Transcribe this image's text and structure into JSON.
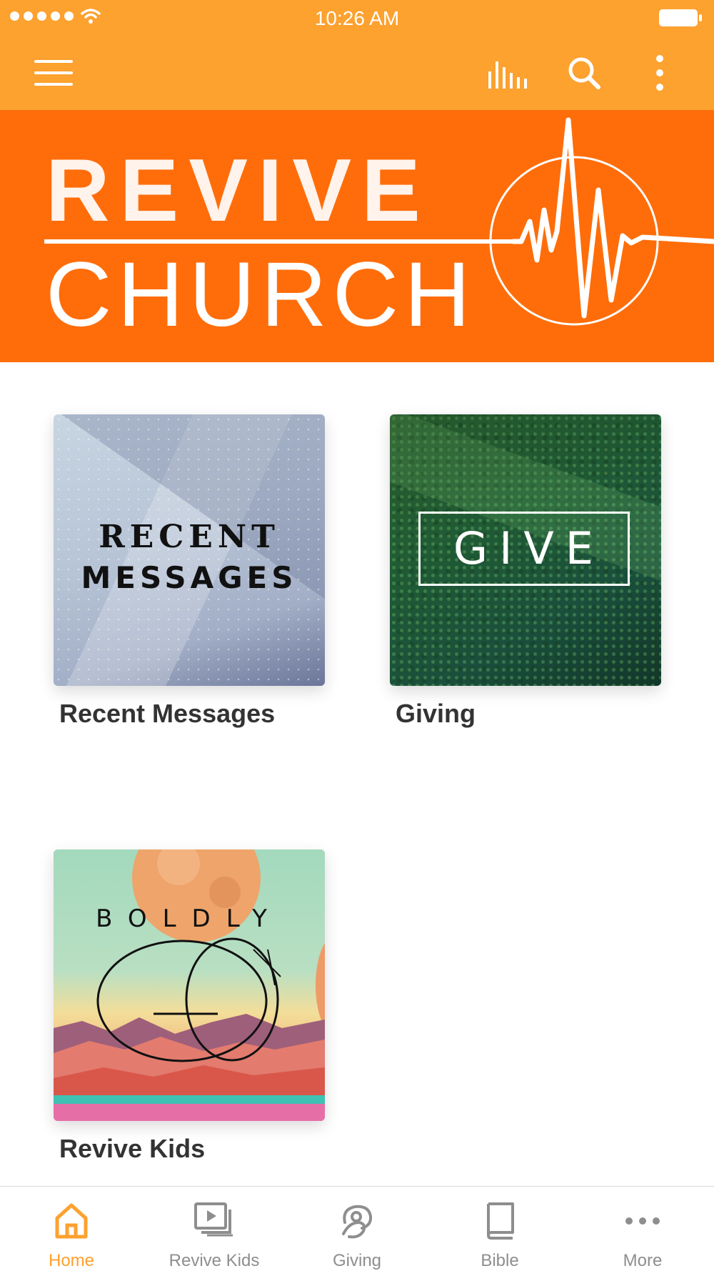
{
  "status_bar": {
    "time": "10:26 AM"
  },
  "toolbar": {
    "menu": "menu-icon",
    "equalizer": "equalizer-icon",
    "search": "search-icon",
    "more": "kebab-icon"
  },
  "banner": {
    "line1": "REVIVE",
    "line2": "CHURCH"
  },
  "tiles": [
    {
      "title": "Recent Messages",
      "art_line1": "RECENT",
      "art_line2": "MESSAGES"
    },
    {
      "title": "Giving",
      "art_text": "GIVE"
    },
    {
      "title": "Revive Kids",
      "art_line1": "BOLDLY",
      "art_line2": "GO"
    }
  ],
  "tabbar": {
    "active": "Home",
    "items": [
      {
        "label": "Home",
        "icon": "home-icon"
      },
      {
        "label": "Revive Kids",
        "icon": "video-stack-icon"
      },
      {
        "label": "Giving",
        "icon": "giving-hand-icon"
      },
      {
        "label": "Bible",
        "icon": "book-icon"
      },
      {
        "label": "More",
        "icon": "more-dots-icon"
      }
    ]
  },
  "colors": {
    "status_toolbar": "#FDA12F",
    "banner": "#FF6D0A",
    "active_tab": "#FDA12F",
    "inactive_tab": "#8E8E8E"
  }
}
